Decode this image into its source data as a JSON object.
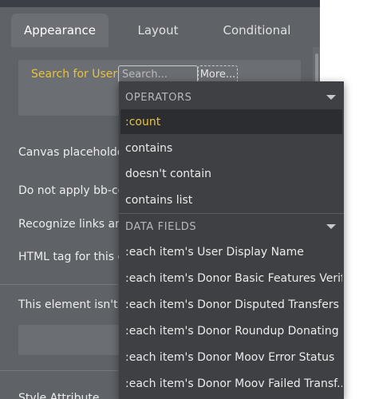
{
  "tabs": [
    {
      "label": "Appearance",
      "active": true
    },
    {
      "label": "Layout",
      "active": false
    },
    {
      "label": "Conditional",
      "active": false
    }
  ],
  "search": {
    "label": "Search for Users",
    "placeholder": "Search...",
    "more_label": "More..."
  },
  "rows": {
    "canvas_placeholder": "Canvas placeholder",
    "bbcode": "Do not apply bb-co",
    "recognize_links": "Recognize links and",
    "html_tag": "HTML tag for this e",
    "not_clickable": "This element isn't c",
    "style_attribute": "Style Attribute"
  },
  "dropdown": {
    "operators_header": "OPERATORS",
    "operators": [
      ":count",
      "contains",
      "doesn't contain",
      "contains list"
    ],
    "data_fields_header": "DATA FIELDS",
    "data_fields": [
      ":each item's User Display Name",
      ":each item's Donor Basic Features Verif...",
      ":each item's Donor Disputed Transfers",
      ":each item's Donor Roundup Donating ...",
      ":each item's Donor Moov Error Status",
      ":each item's Donor Moov Failed Transf..."
    ]
  },
  "colors": {
    "highlight": "#e8c33d",
    "panel": "#5f6266",
    "dropdown": "#3f4043"
  }
}
